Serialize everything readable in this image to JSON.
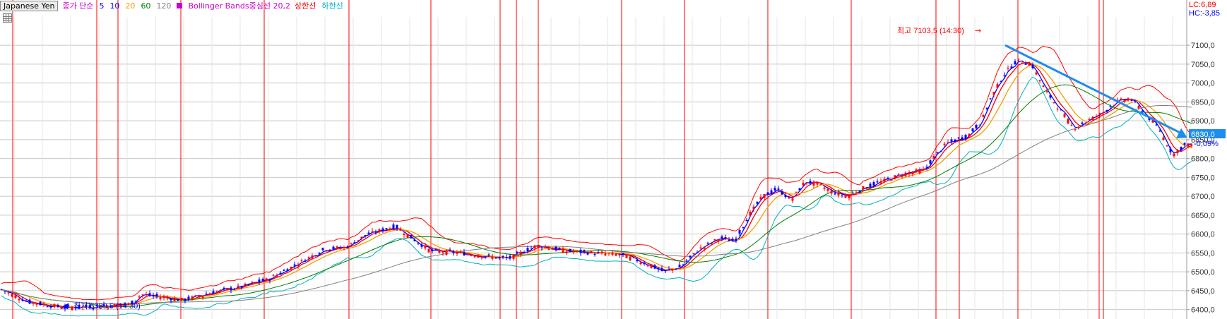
{
  "legend": {
    "symbol": "Japanese Yen",
    "ma_label": "종가 단순",
    "ma5": "5",
    "ma10": "10",
    "ma20": "20",
    "ma60": "60",
    "ma120": "120",
    "bb_label": "Bollinger Bands중심선 20,2",
    "bb_upper": "상한선",
    "bb_lower": "하한선"
  },
  "status": {
    "lc": "LC:6,89",
    "hc": "HC:-3,85"
  },
  "annotations": {
    "high_text": "최고 7103,5 (14:30)",
    "low_text": "최저 6389,5 (14:30)"
  },
  "last_price": {
    "value": "6830,0",
    "change": "-0,09%"
  },
  "chart_data": {
    "type": "candlestick",
    "instrument": "Japanese Yen",
    "ylim": [
      6375,
      7175
    ],
    "yticks": [
      7100,
      7050,
      7000,
      6950,
      6900,
      6850,
      6800,
      6750,
      6700,
      6650,
      6600,
      6550,
      6500,
      6450,
      6400
    ],
    "ytick_labels": [
      "7100,0",
      "7050,0",
      "7000,0",
      "6950,0",
      "6900,0",
      "6850,0",
      "6800,0",
      "6750,0",
      "6700,0",
      "6650,0",
      "6600,0",
      "6550,0",
      "6500,0",
      "6450,0",
      "6400,0"
    ],
    "grid": true,
    "high": 7103.5,
    "low": 6389.5,
    "last": 6830.0,
    "close_path": [
      [
        0,
        6455
      ],
      [
        40,
        6420
      ],
      [
        90,
        6405
      ],
      [
        140,
        6408
      ],
      [
        185,
        6415
      ],
      [
        200,
        6440
      ],
      [
        260,
        6425
      ],
      [
        300,
        6445
      ],
      [
        340,
        6460
      ],
      [
        380,
        6480
      ],
      [
        420,
        6520
      ],
      [
        460,
        6560
      ],
      [
        490,
        6565
      ],
      [
        520,
        6600
      ],
      [
        560,
        6620
      ],
      [
        590,
        6580
      ],
      [
        610,
        6555
      ],
      [
        650,
        6550
      ],
      [
        690,
        6540
      ],
      [
        720,
        6535
      ],
      [
        760,
        6570
      ],
      [
        800,
        6555
      ],
      [
        840,
        6550
      ],
      [
        880,
        6545
      ],
      [
        910,
        6525
      ],
      [
        940,
        6500
      ],
      [
        965,
        6515
      ],
      [
        990,
        6560
      ],
      [
        1020,
        6590
      ],
      [
        1040,
        6580
      ],
      [
        1060,
        6650
      ],
      [
        1080,
        6700
      ],
      [
        1100,
        6720
      ],
      [
        1120,
        6690
      ],
      [
        1140,
        6740
      ],
      [
        1160,
        6730
      ],
      [
        1180,
        6710
      ],
      [
        1200,
        6700
      ],
      [
        1220,
        6720
      ],
      [
        1250,
        6740
      ],
      [
        1280,
        6760
      ],
      [
        1310,
        6770
      ],
      [
        1320,
        6800
      ],
      [
        1340,
        6840
      ],
      [
        1370,
        6860
      ],
      [
        1390,
        6900
      ],
      [
        1400,
        6950
      ],
      [
        1420,
        7020
      ],
      [
        1440,
        7060
      ],
      [
        1460,
        7050
      ],
      [
        1480,
        6980
      ],
      [
        1500,
        6930
      ],
      [
        1520,
        6880
      ],
      [
        1540,
        6900
      ],
      [
        1560,
        6920
      ],
      [
        1580,
        6950
      ],
      [
        1600,
        6960
      ],
      [
        1620,
        6920
      ],
      [
        1640,
        6880
      ],
      [
        1660,
        6810
      ],
      [
        1680,
        6840
      ],
      [
        1690,
        6830
      ]
    ],
    "vertical_markers_x": [
      18,
      137,
      167,
      256,
      374,
      494,
      610,
      708,
      731,
      762,
      880,
      969,
      1087,
      1205,
      1325,
      1358,
      1441,
      1556,
      1562
    ],
    "trend_arrow": {
      "from": [
        1423,
        7100
      ],
      "to": [
        1681,
        6855
      ]
    },
    "indicators": {
      "moving_averages": [
        {
          "period": 5,
          "color": "#0000ff"
        },
        {
          "period": 10,
          "color": "#ff0000"
        },
        {
          "period": 20,
          "color": "#f0a000"
        },
        {
          "period": 60,
          "color": "#008000"
        },
        {
          "period": 120,
          "color": "#808080"
        }
      ],
      "bollinger": {
        "period": 20,
        "k": 2,
        "upper_color": "#ff0000",
        "mid_color": "#cc00cc",
        "lower_color": "#00b0c0"
      }
    }
  },
  "colors": {
    "up": "#ff0000",
    "down": "#0000ff",
    "grid": "#c8c8c8",
    "marker": "#ff0000",
    "arrow": "#1f8cf0",
    "price_bg": "#1f8cf0"
  }
}
